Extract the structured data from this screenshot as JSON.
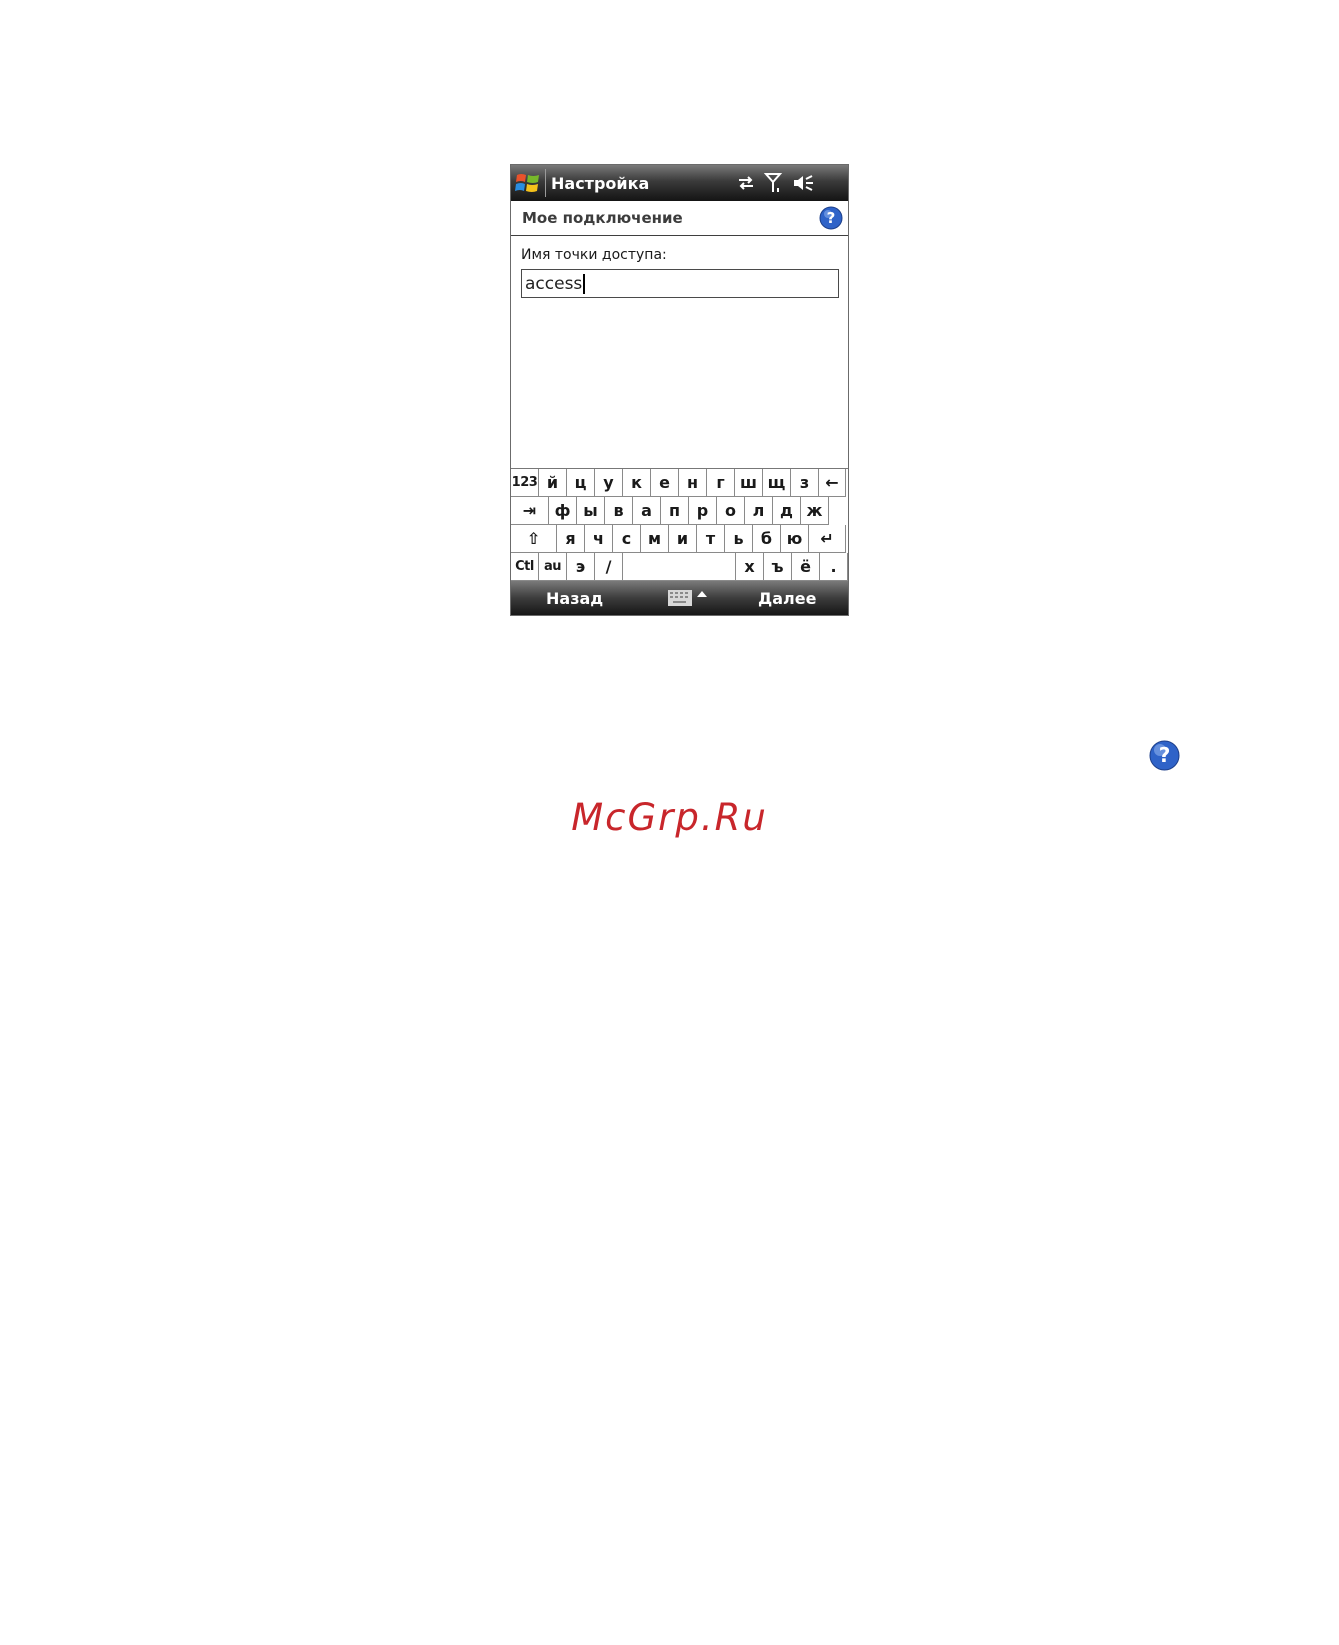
{
  "titlebar": {
    "title": "Настройка",
    "icons": [
      "windows-start-icon",
      "connectivity-icon",
      "signal-icon",
      "speaker-muted-icon"
    ]
  },
  "header": {
    "title": "Мое подключение",
    "help_icon": "help-icon"
  },
  "form": {
    "label": "Имя точки доступа:",
    "value": "access"
  },
  "keyboard": {
    "rows": [
      [
        "123",
        "й",
        "ц",
        "у",
        "к",
        "е",
        "н",
        "г",
        "ш",
        "щ",
        "з",
        "←"
      ],
      [
        "⇥",
        "ф",
        "ы",
        "в",
        "а",
        "п",
        "р",
        "о",
        "л",
        "д",
        "ж"
      ],
      [
        "⇧",
        "я",
        "ч",
        "с",
        "м",
        "и",
        "т",
        "ь",
        "б",
        "ю",
        "↵"
      ],
      [
        "Ctl",
        "au",
        "э",
        "/",
        " ",
        "х",
        "ъ",
        "ё",
        "."
      ]
    ]
  },
  "softkeys": {
    "left": "Назад",
    "right": "Далее",
    "center_icon": "keyboard-icon"
  },
  "watermark": {
    "text": "McGrp.Ru",
    "color": "#c8262b"
  },
  "colors": {
    "help_blue": "#2f63c8",
    "bar_dark": "#1c1c1c"
  }
}
